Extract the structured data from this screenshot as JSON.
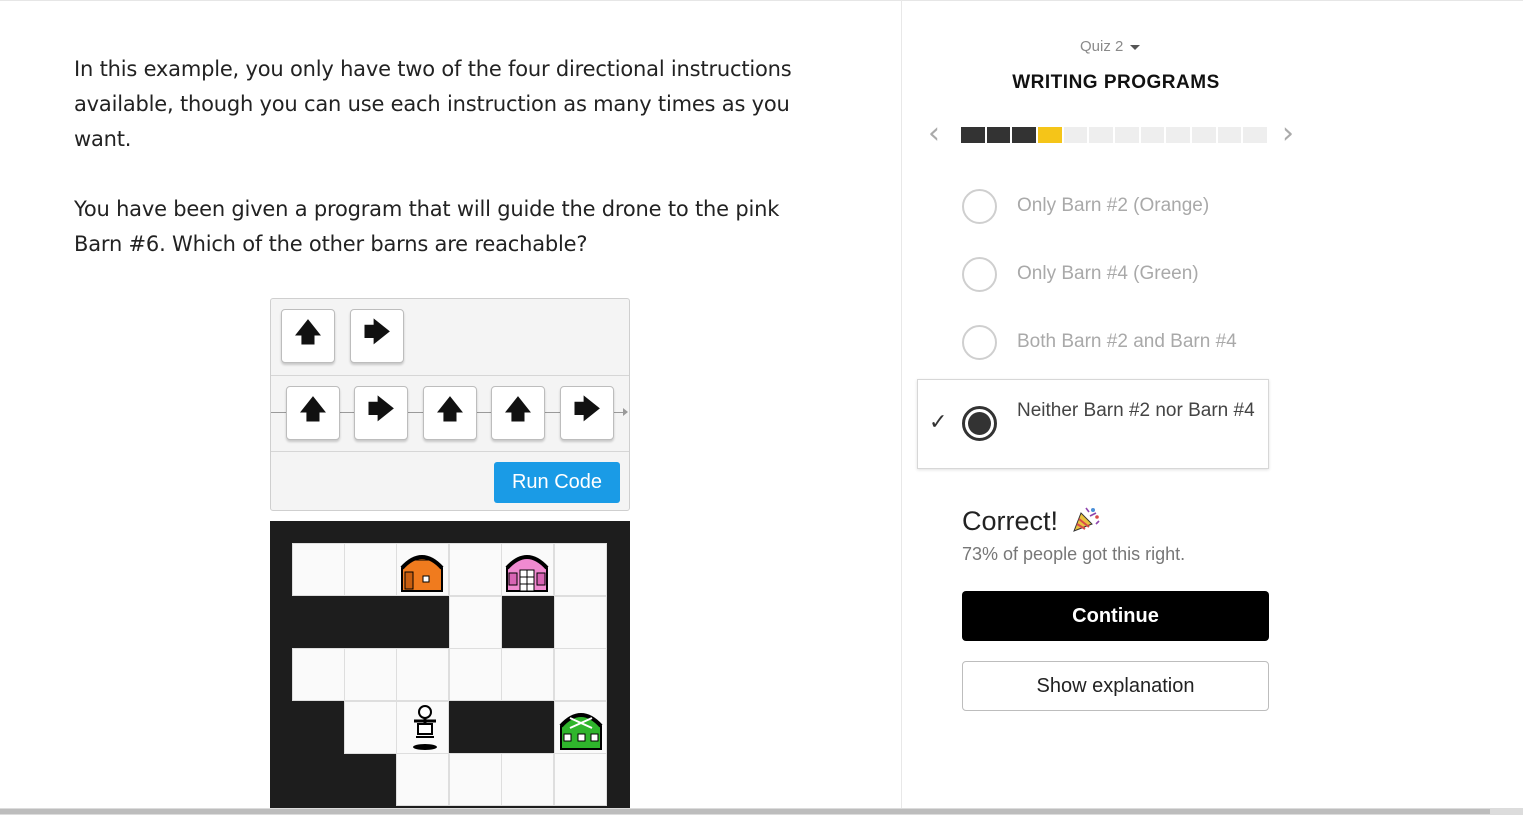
{
  "lesson": {
    "paragraph_1": "In this example, you only have two of the four directional instructions available, though you can use each instruction as many times as you want.",
    "paragraph_2": "You have been given a program that will guide the drone to the pink Barn #6. Which of the other barns are reachable?"
  },
  "code_panel": {
    "palette": [
      {
        "icon": "arrow-up-icon",
        "glyph": "🡅"
      },
      {
        "icon": "arrow-right-icon",
        "glyph": "🡆"
      }
    ],
    "program": [
      {
        "icon": "arrow-up-icon",
        "glyph": "🡅"
      },
      {
        "icon": "arrow-right-icon",
        "glyph": "🡆"
      },
      {
        "icon": "arrow-up-icon",
        "glyph": "🡅"
      },
      {
        "icon": "arrow-up-icon",
        "glyph": "🡅"
      },
      {
        "icon": "arrow-right-icon",
        "glyph": "🡆"
      }
    ],
    "run_label": "Run Code"
  },
  "map": {
    "barns": [
      {
        "name": "orange-barn",
        "color": "#f07b1e"
      },
      {
        "name": "pink-barn",
        "color": "#f08ad0"
      },
      {
        "name": "green-barn",
        "color": "#2fb52c"
      }
    ],
    "drone": "drone-icon"
  },
  "quiz": {
    "label": "Quiz 2",
    "title": "WRITING PROGRAMS",
    "progress": {
      "total": 12,
      "completed": 3,
      "current": 4
    },
    "options": [
      "Only Barn #2 (Orange)",
      "Only Barn #4 (Green)",
      "Both Barn #2 and Barn #4",
      "Neither Barn #2 nor Barn #4"
    ],
    "selected_index": 3,
    "result_title": "Correct!",
    "result_stat": "73% of people got this right.",
    "continue_label": "Continue",
    "explain_label": "Show explanation"
  },
  "colors": {
    "accent_blue": "#1a9be6",
    "progress_done": "#333333",
    "progress_current": "#f5c518"
  }
}
